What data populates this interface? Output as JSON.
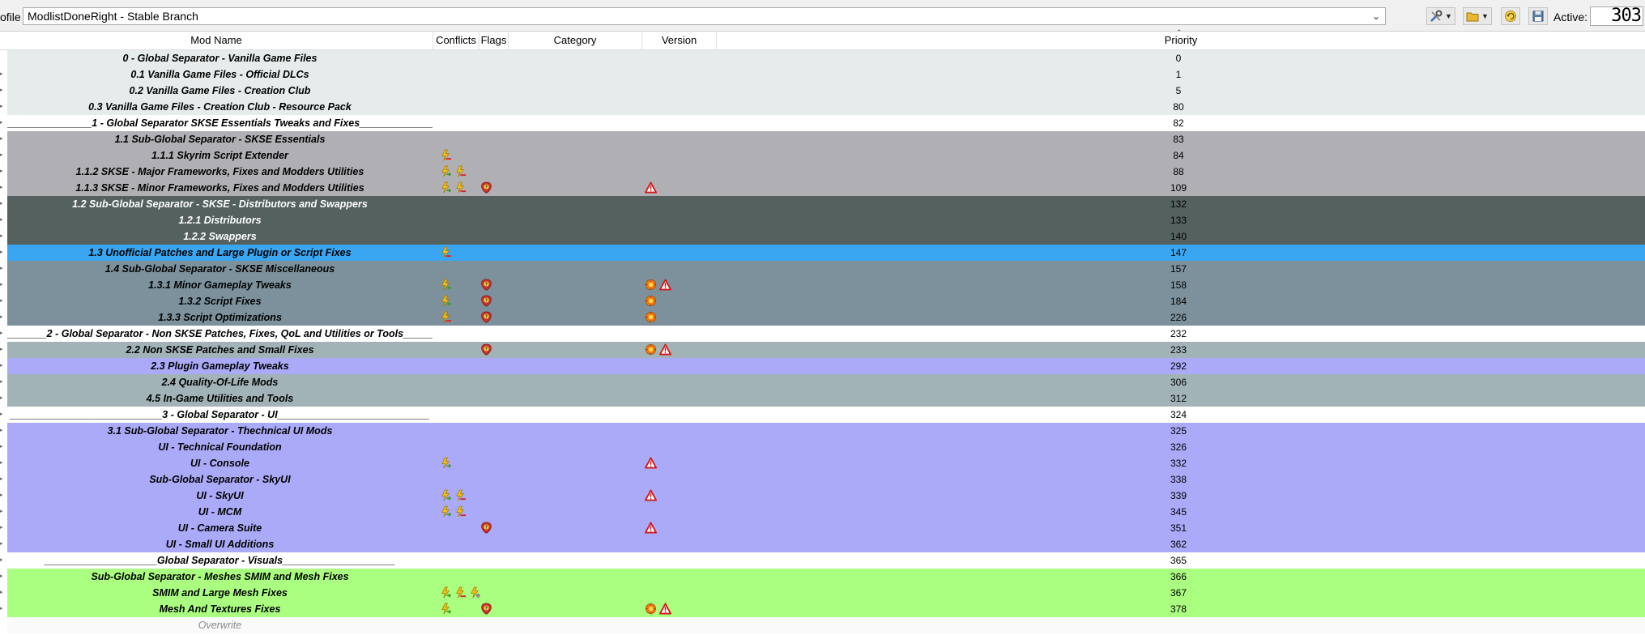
{
  "toolbar": {
    "profile_label": "ofile",
    "profile_value": "ModlistDoneRight - Stable Branch",
    "active_label": "Active:",
    "active_count": "303"
  },
  "columns": {
    "mod_name": "Mod Name",
    "conflicts": "Conflicts",
    "flags": "Flags",
    "category": "Category",
    "version": "Version",
    "priority": "Priority"
  },
  "colors": {
    "lightgray": "#e6ebeb",
    "white": "#ffffff",
    "midgray": "#b0b0b4",
    "darkslate": "#55615f",
    "blue": "#3aa6f2",
    "steel": "#7c919c",
    "lavender": "#aaaaf8",
    "bluegray": "#a2b3b8",
    "green": "#aafe80"
  },
  "rows": [
    {
      "name": "0 - Global Separator - Vanilla Game Files",
      "priority": "0",
      "bg": "#e6ebeb",
      "fg": "#000000",
      "conflicts": [],
      "flags": [],
      "version": []
    },
    {
      "name": "0.1 Vanilla Game Files - Official DLCs",
      "priority": "1",
      "bg": "#e6ebeb",
      "fg": "#000000",
      "conflicts": [],
      "flags": [],
      "version": []
    },
    {
      "name": "0.2 Vanilla Game Files - Creation Club",
      "priority": "5",
      "bg": "#e6ebeb",
      "fg": "#000000",
      "conflicts": [],
      "flags": [],
      "version": []
    },
    {
      "name": "0.3 Vanilla Game Files - Creation Club - Resource Pack",
      "priority": "80",
      "bg": "#e6ebeb",
      "fg": "#000000",
      "conflicts": [],
      "flags": [],
      "version": []
    },
    {
      "name": "_______________1 - Global Separator SKSE Essentials Tweaks and Fixes_______________",
      "priority": "82",
      "bg": "#ffffff",
      "fg": "#000000",
      "conflicts": [],
      "flags": [],
      "version": []
    },
    {
      "name": "1.1 Sub-Global Separator - SKSE Essentials",
      "priority": "83",
      "bg": "#b0b0b4",
      "fg": "#000000",
      "conflicts": [],
      "flags": [],
      "version": []
    },
    {
      "name": "1.1.1 Skyrim Script Extender",
      "priority": "84",
      "bg": "#b0b0b4",
      "fg": "#000000",
      "conflicts": [
        "overwritten"
      ],
      "flags": [],
      "version": []
    },
    {
      "name": "1.1.2 SKSE - Major Frameworks, Fixes and Modders Utilities",
      "priority": "88",
      "bg": "#b0b0b4",
      "fg": "#000000",
      "conflicts": [
        "overwrite",
        "overwritten"
      ],
      "flags": [],
      "version": []
    },
    {
      "name": "1.1.3 SKSE - Minor Frameworks, Fixes and Modders Utilities",
      "priority": "109",
      "bg": "#b0b0b4",
      "fg": "#000000",
      "conflicts": [
        "overwrite",
        "overwritten"
      ],
      "flags": [
        "notes"
      ],
      "version": [
        "warning"
      ]
    },
    {
      "name": "1.2 Sub-Global Separator - SKSE - Distributors and Swappers",
      "priority": "132",
      "bg": "#55615f",
      "fg": "#ffffff",
      "conflicts": [],
      "flags": [],
      "version": []
    },
    {
      "name": "1.2.1 Distributors",
      "priority": "133",
      "bg": "#55615f",
      "fg": "#ffffff",
      "conflicts": [],
      "flags": [],
      "version": []
    },
    {
      "name": "1.2.2 Swappers",
      "priority": "140",
      "bg": "#55615f",
      "fg": "#ffffff",
      "conflicts": [],
      "flags": [],
      "version": []
    },
    {
      "name": "1.3 Unofficial Patches and Large Plugin or Script Fixes",
      "priority": "147",
      "bg": "#3aa6f2",
      "fg": "#000000",
      "conflicts": [
        "overwritten"
      ],
      "flags": [],
      "version": []
    },
    {
      "name": "1.4 Sub-Global Separator - SKSE Miscellaneous",
      "priority": "157",
      "bg": "#7c919c",
      "fg": "#000000",
      "conflicts": [],
      "flags": [],
      "version": []
    },
    {
      "name": "1.3.1 Minor Gameplay Tweaks",
      "priority": "158",
      "bg": "#7c919c",
      "fg": "#000000",
      "conflicts": [
        "overwrite"
      ],
      "flags": [
        "notes"
      ],
      "version": [
        "update",
        "warning"
      ]
    },
    {
      "name": "1.3.2 Script Fixes",
      "priority": "184",
      "bg": "#7c919c",
      "fg": "#000000",
      "conflicts": [
        "overwrite"
      ],
      "flags": [
        "notes"
      ],
      "version": [
        "update"
      ]
    },
    {
      "name": "1.3.3 Script Optimizations",
      "priority": "226",
      "bg": "#7c919c",
      "fg": "#000000",
      "conflicts": [
        "overwritten"
      ],
      "flags": [
        "notes"
      ],
      "version": [
        "update"
      ]
    },
    {
      "name": "_______2 - Global Separator - Non SKSE Patches, Fixes, QoL and Utilities or Tools_______",
      "priority": "232",
      "bg": "#ffffff",
      "fg": "#000000",
      "conflicts": [],
      "flags": [],
      "version": []
    },
    {
      "name": "2.2 Non SKSE Patches and Small Fixes",
      "priority": "233",
      "bg": "#a2b3b8",
      "fg": "#000000",
      "conflicts": [],
      "flags": [
        "notes"
      ],
      "version": [
        "update",
        "warning"
      ]
    },
    {
      "name": "2.3 Plugin Gameplay Tweaks",
      "priority": "292",
      "bg": "#aaaaf8",
      "fg": "#000000",
      "conflicts": [],
      "flags": [],
      "version": []
    },
    {
      "name": "2.4 Quality-Of-Life Mods",
      "priority": "306",
      "bg": "#a2b3b8",
      "fg": "#000000",
      "conflicts": [],
      "flags": [],
      "version": []
    },
    {
      "name": "4.5 In-Game Utilities and Tools",
      "priority": "312",
      "bg": "#a2b3b8",
      "fg": "#000000",
      "conflicts": [],
      "flags": [],
      "version": []
    },
    {
      "name": "___________________________3 - Global Separator - UI___________________________",
      "priority": "324",
      "bg": "#ffffff",
      "fg": "#000000",
      "conflicts": [],
      "flags": [],
      "version": []
    },
    {
      "name": "3.1 Sub-Global Separator - Thechnical UI Mods",
      "priority": "325",
      "bg": "#aaaaf8",
      "fg": "#000000",
      "conflicts": [],
      "flags": [],
      "version": []
    },
    {
      "name": "UI - Technical Foundation",
      "priority": "326",
      "bg": "#aaaaf8",
      "fg": "#000000",
      "conflicts": [],
      "flags": [],
      "version": []
    },
    {
      "name": "UI - Console",
      "priority": "332",
      "bg": "#aaaaf8",
      "fg": "#000000",
      "conflicts": [
        "overwrite"
      ],
      "flags": [],
      "version": [
        "warning"
      ]
    },
    {
      "name": "Sub-Global Separator - SkyUI",
      "priority": "338",
      "bg": "#aaaaf8",
      "fg": "#000000",
      "conflicts": [],
      "flags": [],
      "version": []
    },
    {
      "name": "UI - SkyUI",
      "priority": "339",
      "bg": "#aaaaf8",
      "fg": "#000000",
      "conflicts": [
        "overwrite",
        "overwritten"
      ],
      "flags": [],
      "version": [
        "warning"
      ]
    },
    {
      "name": "UI - MCM",
      "priority": "345",
      "bg": "#aaaaf8",
      "fg": "#000000",
      "conflicts": [
        "overwrite",
        "overwritten"
      ],
      "flags": [],
      "version": []
    },
    {
      "name": "UI - Camera Suite",
      "priority": "351",
      "bg": "#aaaaf8",
      "fg": "#000000",
      "conflicts": [],
      "flags": [
        "notes"
      ],
      "version": [
        "warning"
      ]
    },
    {
      "name": "UI - Small UI Additions",
      "priority": "362",
      "bg": "#aaaaf8",
      "fg": "#000000",
      "conflicts": [],
      "flags": [],
      "version": []
    },
    {
      "name": "____________________Global Separator - Visuals____________________",
      "priority": "365",
      "bg": "#ffffff",
      "fg": "#000000",
      "conflicts": [],
      "flags": [],
      "version": []
    },
    {
      "name": "Sub-Global Separator - Meshes SMIM and Mesh Fixes",
      "priority": "366",
      "bg": "#aafe80",
      "fg": "#000000",
      "conflicts": [],
      "flags": [],
      "version": []
    },
    {
      "name": "SMIM and Large Mesh Fixes",
      "priority": "367",
      "bg": "#aafe80",
      "fg": "#000000",
      "conflicts": [
        "overwrite",
        "overwritten",
        "redundant"
      ],
      "flags": [],
      "version": []
    },
    {
      "name": "Mesh And Textures Fixes",
      "priority": "378",
      "bg": "#aafe80",
      "fg": "#000000",
      "conflicts": [
        "overwrite"
      ],
      "flags": [
        "notes"
      ],
      "version": [
        "update",
        "warning"
      ]
    }
  ],
  "overwrite_row": {
    "name": "Overwrite"
  }
}
